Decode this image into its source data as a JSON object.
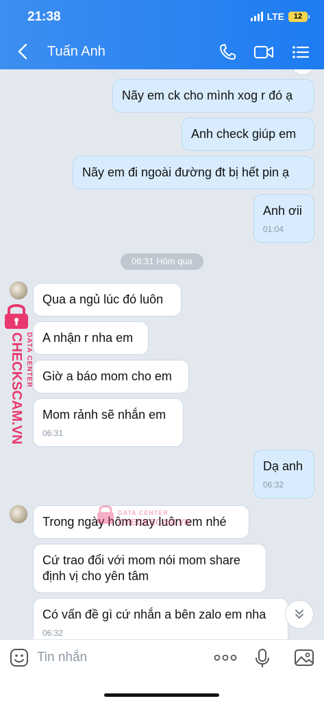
{
  "status": {
    "time": "21:38",
    "network": "LTE",
    "battery": "12"
  },
  "header": {
    "contact_name": "Tuấn Anh"
  },
  "messages": {
    "m1": {
      "text": "Nãy em ck cho mình xog r đó ạ"
    },
    "m2": {
      "text": "Anh check giúp em"
    },
    "m3": {
      "text": "Nãy em đi ngoài đường đt bị hết pin ạ"
    },
    "m4": {
      "text": "Anh ơii",
      "time": "01:04"
    },
    "separator": "06:31 Hôm qua",
    "m5": {
      "text": "Qua a ngủ lúc đó luôn"
    },
    "m6": {
      "text": "A nhận r nha em"
    },
    "m7": {
      "text": "Giờ a báo mom cho em"
    },
    "m8": {
      "text": "Mom rảnh sẽ nhắn em",
      "time": "06:31"
    },
    "m9": {
      "text": "Dạ anh",
      "time": "06:32"
    },
    "m10": {
      "text": "Trong ngày hôm nay luôn em nhé"
    },
    "m11": {
      "line1": "Cứ trao đổi với mom nói mom share",
      "line2": "định vị cho yên tâm"
    },
    "m12": {
      "text": "Có vấn đề gì cứ nhắn a bên zalo em nha",
      "time": "06:32"
    }
  },
  "watermark": {
    "line1": "DATA CENTER",
    "line2": "CHECKSCAM.VN"
  },
  "composer": {
    "placeholder": "Tin nhắn"
  },
  "colors": {
    "header": "#1d7cf2",
    "outgoing_bubble": "#d8ecfd",
    "incoming_bubble": "#ffffff",
    "chat_bg": "#e3e8ef",
    "watermark": "#e8386d"
  },
  "icons": [
    "back-icon",
    "phone-icon",
    "video-call-icon",
    "menu-list-icon",
    "sticker-icon",
    "more-icon",
    "microphone-icon",
    "image-icon",
    "chevron-down-icon"
  ]
}
